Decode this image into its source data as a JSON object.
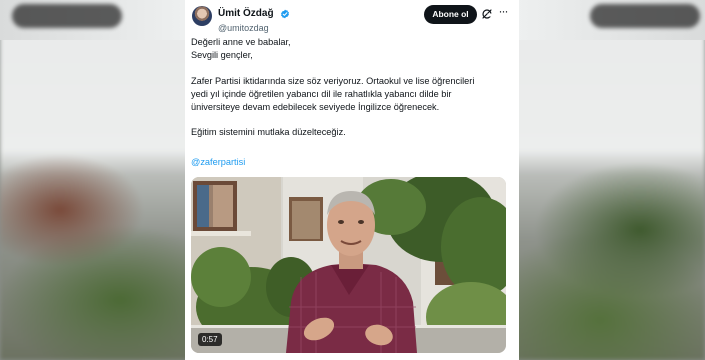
{
  "tweet": {
    "author": {
      "display_name": "Ümit Özdağ",
      "handle": "@umitozdag",
      "verified": true,
      "verified_color": "#1d9bf0"
    },
    "follow_label": "Abone ol",
    "icons": {
      "grok": "grok-icon",
      "more": "more-icon"
    },
    "text": {
      "greeting_1": "Değerli anne ve babalar,",
      "greeting_2": "Sevgili gençler,",
      "paragraph_1": "Zafer Partisi iktidarında size söz veriyoruz. Ortaokul ve lise öğrencileri\nyedi yıl içinde öğretilen yabancı dil ile rahatlıkla yabancı dilde bir\nüniversiteye devam edebilecek seviyede İngilizce öğrenecek.",
      "paragraph_2": "Eğitim sistemini mutlaka düzelteceğiz.",
      "mention": "@zaferpartisi"
    },
    "media": {
      "type": "video",
      "duration": "0:57"
    }
  },
  "colors": {
    "text": "#0f1419",
    "secondary_text": "#536471",
    "link": "#1d9bf0",
    "button_bg": "#0f1419",
    "button_text": "#ffffff"
  }
}
